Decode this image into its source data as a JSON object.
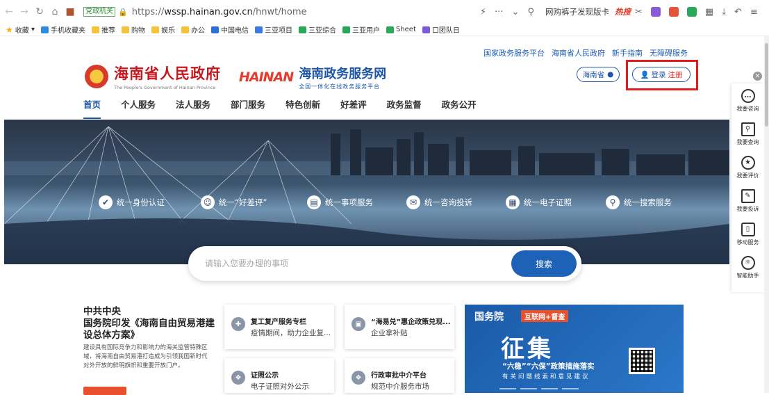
{
  "browser": {
    "site_badge": "党政机关",
    "url_prefix": "https://",
    "url_domain": "wssp.hainan.gov.cn",
    "url_path": "/hnwt/home",
    "search_hint": "网购裤子发现版卡",
    "hot_label": "热搜",
    "bookmarks": [
      "收藏",
      "手机收藏夹",
      "推荐",
      "购物",
      "娱乐",
      "办公",
      "中国电信",
      "三亚项目",
      "三亚综合",
      "三亚用户",
      "Sheet",
      "口团队日"
    ]
  },
  "top_links": [
    "国家政务服务平台",
    "海南省人民政府",
    "新手指南",
    "无障碍服务"
  ],
  "logo_gov": {
    "title": "海南省人民政府",
    "subtitle": "The People's Government of Hainan Province"
  },
  "logo_service": {
    "brand": "HAINAN",
    "title": "海南政务服务网",
    "subtitle": "全国一体化在线政务服务平台"
  },
  "region_selector": "海南省",
  "login": {
    "login_label": "登录",
    "register_label": "注册"
  },
  "main_nav": [
    "首页",
    "个人服务",
    "法人服务",
    "部门服务",
    "特色创新",
    "好差评",
    "政务监督",
    "政务公开"
  ],
  "banner_services": [
    "统一身份认证",
    "统一“好差评”",
    "统一事项服务",
    "统一咨询投诉",
    "统一电子证照",
    "统一搜索服务"
  ],
  "search": {
    "placeholder": "请输入您要办理的事项",
    "button_label": "搜索"
  },
  "news": {
    "line1": "中共中央",
    "headline": "国务院印发《海南自由贸易港建设总体方案》",
    "body": "建设具有国际竞争力和影响力的海关监管特殊区域，将海南自由贸易港打造成为引领我国新时代对外开放的鲜明旗帜和重要开放门户。"
  },
  "cards": [
    {
      "title": "复工复产服务专栏",
      "subtitle": "疫情期间，助力企业复..."
    },
    {
      "title": "“海易兑”惠企政策兑现...",
      "subtitle": "企业拿补贴"
    },
    {
      "title": "证照公示",
      "subtitle": "电子证照对外公示"
    },
    {
      "title": "行政审批中介平台",
      "subtitle": "规范中介服务市场"
    }
  ],
  "promo": {
    "head": "国务院",
    "tag": "互联网+督查",
    "big": "征集",
    "line1": "“六稳”“六保”政策措施落实",
    "line2": "有关问题线索和意见建议"
  },
  "sidebar": [
    "我要咨询",
    "我要查询",
    "我要评价",
    "我要投诉",
    "移动服务",
    "智能助手"
  ]
}
